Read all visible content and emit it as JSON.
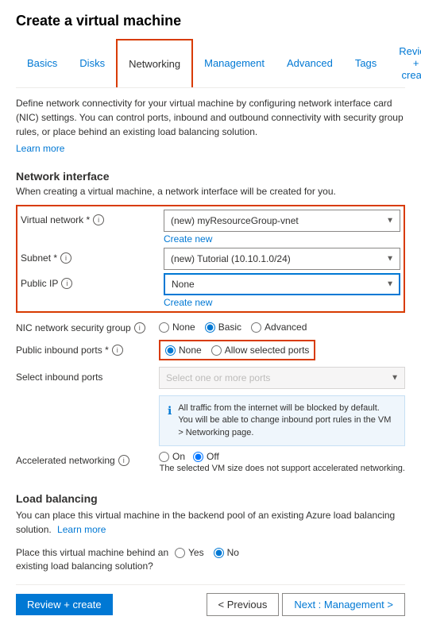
{
  "page": {
    "title": "Create a virtual machine"
  },
  "tabs": [
    {
      "label": "Basics",
      "active": false
    },
    {
      "label": "Disks",
      "active": false
    },
    {
      "label": "Networking",
      "active": true
    },
    {
      "label": "Management",
      "active": false
    },
    {
      "label": "Advanced",
      "active": false
    },
    {
      "label": "Tags",
      "active": false
    },
    {
      "label": "Review + create",
      "active": false
    }
  ],
  "description": "Define network connectivity for your virtual machine by configuring network interface card (NIC) settings. You can control ports, inbound and outbound connectivity with security group rules, or place behind an existing load balancing solution.",
  "learn_more_link": "Learn more",
  "network_interface": {
    "title": "Network interface",
    "subtitle": "When creating a virtual machine, a network interface will be created for you.",
    "fields": {
      "virtual_network": {
        "label": "Virtual network *",
        "value": "(new) myResourceGroup-vnet",
        "create_new": "Create new"
      },
      "subnet": {
        "label": "Subnet *",
        "value": "(new) Tutorial (10.10.1.0/24)"
      },
      "public_ip": {
        "label": "Public IP",
        "value": "None",
        "create_new": "Create new"
      },
      "nic_security_group": {
        "label": "NIC network security group",
        "options": [
          "None",
          "Basic",
          "Advanced"
        ],
        "selected": "Basic"
      },
      "public_inbound_ports": {
        "label": "Public inbound ports *",
        "options": [
          "None",
          "Allow selected ports"
        ],
        "selected": "None"
      },
      "select_inbound_ports": {
        "label": "Select inbound ports",
        "placeholder": "Select one or more ports"
      }
    },
    "info_message": "All traffic from the internet will be blocked by default. You will be able to change inbound port rules in the VM > Networking page."
  },
  "accelerated_networking": {
    "label": "Accelerated networking",
    "on_label": "On",
    "off_label": "Off",
    "selected": "Off",
    "note": "The selected VM size does not support accelerated networking."
  },
  "load_balancing": {
    "title": "Load balancing",
    "description": "You can place this virtual machine in the backend pool of an existing Azure load balancing solution.",
    "learn_more": "Learn more",
    "field_label": "Place this virtual machine behind an existing load balancing solution?",
    "options": [
      "Yes",
      "No"
    ],
    "selected": "No"
  },
  "footer": {
    "review_create": "Review + create",
    "previous": "< Previous",
    "next": "Next : Management >"
  }
}
